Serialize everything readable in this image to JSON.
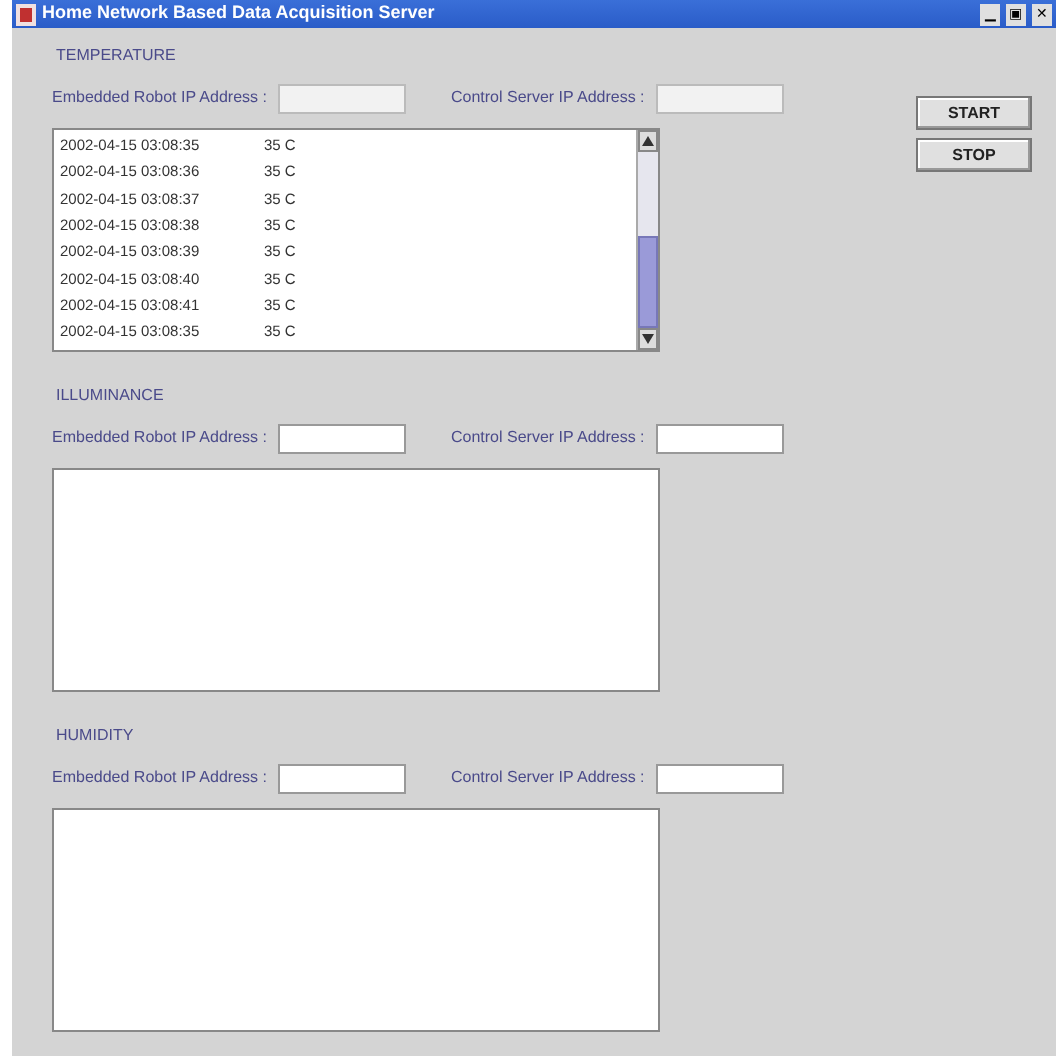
{
  "window": {
    "title": "Home Network Based Data Acquisition Server",
    "controls": [
      "▁",
      "▣",
      "✕"
    ]
  },
  "sections": [
    {
      "title": "TEMPERATURE",
      "robot_label": "Embedded Robot IP Address :",
      "server_label": "Control Server IP Address :",
      "disabled": true,
      "rows": [
        {
          "time": "2002-04-15 03:08:35",
          "value": "35 C"
        },
        {
          "time": "2002-04-15 03:08:36",
          "value": "35 C"
        },
        {
          "time": "2002-04-15 03:08:37",
          "value": "35 C"
        },
        {
          "time": "2002-04-15 03:08:38",
          "value": "35 C"
        },
        {
          "time": "2002-04-15 03:08:39",
          "value": "35 C"
        },
        {
          "time": "2002-04-15 03:08:40",
          "value": "35 C"
        },
        {
          "time": "2002-04-15 03:08:41",
          "value": "35 C"
        },
        {
          "time": "2002-04-15 03:08:35",
          "value": "35 C"
        }
      ]
    },
    {
      "title": "ILLUMINANCE",
      "robot_label": "Embedded Robot IP Address :",
      "server_label": "Control Server IP Address :",
      "disabled": false
    },
    {
      "title": "HUMIDITY",
      "robot_label": "Embedded Robot IP Address :",
      "server_label": "Control Server IP Address :",
      "disabled": false
    }
  ],
  "buttons": [
    "START",
    "STOP"
  ]
}
